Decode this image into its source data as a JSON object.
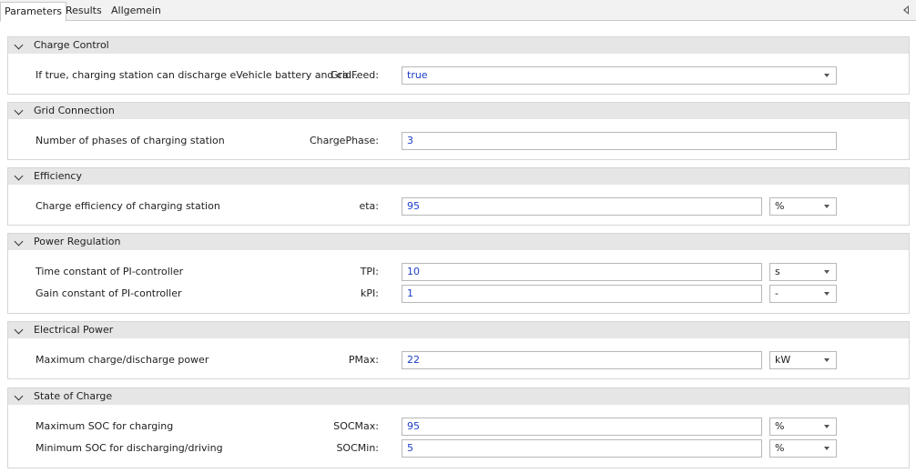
{
  "tabs": [
    {
      "label": "Parameters",
      "active": true
    },
    {
      "label": "Results",
      "active": false
    },
    {
      "label": "Allgemein",
      "active": false
    }
  ],
  "groups": [
    {
      "title": "Charge Control",
      "rows": [
        {
          "description": "If true, charging station can discharge eVehicle battery and ca...",
          "name": "GridFeed:",
          "value": "true",
          "type": "dropdown"
        }
      ]
    },
    {
      "title": "Grid Connection",
      "rows": [
        {
          "description": "Number of phases of charging station",
          "name": "ChargePhase:",
          "value": "3",
          "type": "text"
        }
      ]
    },
    {
      "title": "Efficiency",
      "rows": [
        {
          "description": "Charge efficiency of charging station",
          "name": "eta:",
          "value": "95",
          "unit": "%",
          "type": "text"
        }
      ]
    },
    {
      "title": "Power Regulation",
      "rows": [
        {
          "description": "Time constant of PI-controller",
          "name": "TPI:",
          "value": "10",
          "unit": "s",
          "type": "text"
        },
        {
          "description": "Gain constant of PI-controller",
          "name": "kPI:",
          "value": "1",
          "unit": "-",
          "type": "text"
        }
      ]
    },
    {
      "title": "Electrical Power",
      "rows": [
        {
          "description": "Maximum charge/discharge power",
          "name": "PMax:",
          "value": "22",
          "unit": "kW",
          "type": "text"
        }
      ]
    },
    {
      "title": "State of Charge",
      "rows": [
        {
          "description": "Maximum SOC for charging",
          "name": "SOCMax:",
          "value": "95",
          "unit": "%",
          "type": "text"
        },
        {
          "description": "Minimum SOC for discharging/driving",
          "name": "SOCMin:",
          "value": "5",
          "unit": "%",
          "type": "text"
        }
      ]
    }
  ],
  "icons": {
    "group_toggle": "chevron-down-icon",
    "dropdown": "caret-down-icon",
    "panel_collapse": "panel-collapse-icon"
  },
  "colors": {
    "value_text": "#1c3ec8",
    "group_header": "#e6e6e6"
  }
}
